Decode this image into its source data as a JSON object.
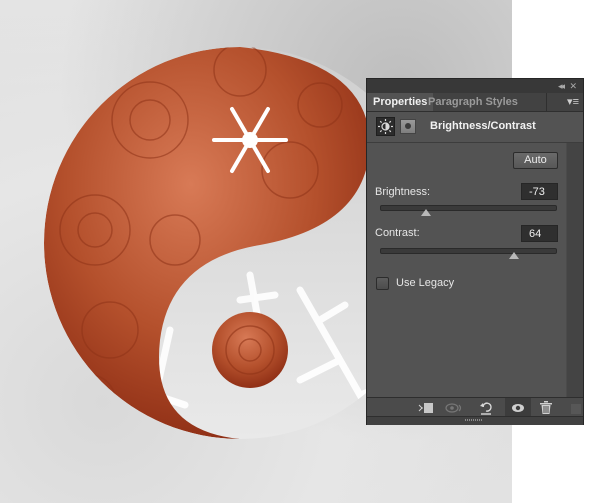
{
  "panel": {
    "titlebar": {
      "collapse_icon": "double-chevron-left-icon",
      "close_icon": "close-icon",
      "collapse_glyph": "◂◂",
      "close_glyph": "✕"
    },
    "tabs": [
      {
        "label": "Properties",
        "active": true
      },
      {
        "label": "Paragraph Styles",
        "active": false
      }
    ],
    "menu_glyph": "▾≡",
    "adjustment": {
      "icon": "brightness-contrast-icon",
      "mask_icon": "layer-mask-icon",
      "title": "Brightness/Contrast"
    },
    "auto_label": "Auto",
    "brightness": {
      "label": "Brightness:",
      "value": "-73",
      "min": -150,
      "max": 150,
      "numeric": -73
    },
    "contrast": {
      "label": "Contrast:",
      "value": "64",
      "min": -50,
      "max": 100,
      "numeric": 64
    },
    "use_legacy": {
      "label": "Use Legacy",
      "checked": false
    },
    "footer_buttons": [
      {
        "name": "clip-to-layer-button",
        "icon": "clip-to-layer-icon",
        "active": false
      },
      {
        "name": "view-previous-state-button",
        "icon": "eye-previous-icon",
        "active": false
      },
      {
        "name": "reset-button",
        "icon": "reset-icon",
        "active": false
      },
      {
        "name": "toggle-visibility-button",
        "icon": "eye-icon",
        "active": true
      },
      {
        "name": "delete-button",
        "icon": "trash-icon",
        "active": false
      }
    ]
  },
  "colors": {
    "panel_bg": "#535353",
    "rose_accent": "#b4502c",
    "snow_white": "#ffffff"
  }
}
